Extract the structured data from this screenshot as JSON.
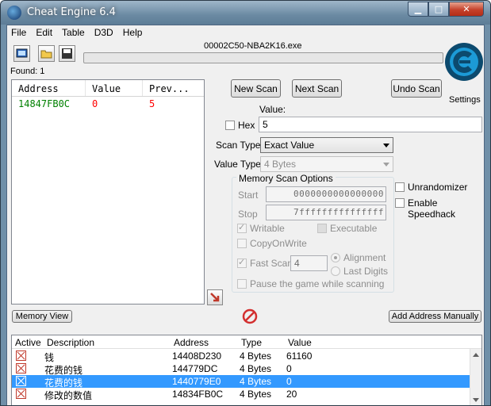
{
  "window": {
    "title": "Cheat Engine 6.4"
  },
  "menu": [
    "File",
    "Edit",
    "Table",
    "D3D",
    "Help"
  ],
  "process": {
    "name": "00002C50-NBA2K16.exe",
    "progress_percent": 0
  },
  "found_label": "Found: 1",
  "found_list": {
    "columns": [
      "Address",
      "Value",
      "Prev..."
    ],
    "rows": [
      {
        "address": "14847FB0C",
        "value": "0",
        "previous": "5"
      }
    ]
  },
  "buttons": {
    "new_scan": "New Scan",
    "next_scan": "Next Scan",
    "undo_scan": "Undo Scan",
    "settings": "Settings",
    "memory_view": "Memory View",
    "add_address_manually": "Add Address Manually"
  },
  "scan": {
    "value_label": "Value:",
    "hex_label": "Hex",
    "value": "5",
    "scan_type_label": "Scan Type",
    "scan_type": "Exact Value",
    "value_type_label": "Value Type",
    "value_type": "4 Bytes"
  },
  "memory_options": {
    "title": "Memory Scan Options",
    "start_label": "Start",
    "start_value": "0000000000000000",
    "stop_label": "Stop",
    "stop_value": "7fffffffffffffff",
    "writable": "Writable",
    "executable": "Executable",
    "copy_on_write": "CopyOnWrite",
    "fast_scan": "Fast Scan",
    "fast_scan_value": "4",
    "alignment": "Alignment",
    "last_digits": "Last Digits",
    "pause_game": "Pause the game while scanning"
  },
  "extra_options": {
    "unrandomizer": "Unrandomizer",
    "enable_speedhack": "Enable Speedhack"
  },
  "address_table": {
    "columns": [
      "Active",
      "Description",
      "Address",
      "Type",
      "Value"
    ],
    "rows": [
      {
        "description": "钱",
        "address": "14408D230",
        "type": "4 Bytes",
        "value": "61160"
      },
      {
        "description": "花费的钱",
        "address": "144779DC",
        "type": "4 Bytes",
        "value": "0"
      },
      {
        "description": "花费的钱",
        "address": "1440779E0",
        "type": "4 Bytes",
        "value": "0",
        "selected": true
      },
      {
        "description": "修改的数值",
        "address": "14834FB0C",
        "type": "4 Bytes",
        "value": "20"
      }
    ]
  },
  "colors": {
    "found_address": "#008000",
    "found_value": "#ff0000",
    "selection": "#3399ff"
  }
}
